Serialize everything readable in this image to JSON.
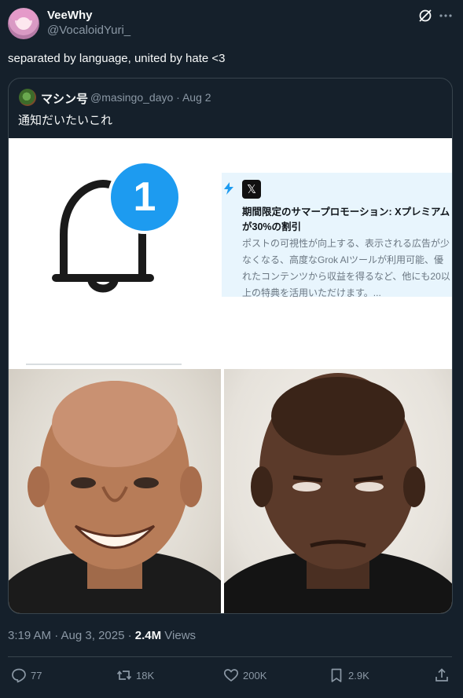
{
  "tweet": {
    "author_name": "VeeWhy",
    "author_handle": "@VocaloidYuri_",
    "text": "separated by language, united by hate <3",
    "timestamp": "3:19 AM · Aug 3, 2025 · ",
    "views_count": "2.4M",
    "views_label": " Views"
  },
  "quote": {
    "author_name": "マシン号",
    "author_handle": "@masingo_dayo · Aug 2",
    "text": "通知だいたいこれ",
    "notification_count": "1",
    "promo": {
      "logo": "𝕏",
      "title": "期間限定のサマープロモーション: Xプレミアムが30%の割引",
      "body": "ポストの可視性が向上する、表示される広告が少なくなる、高度なGrok AIツールが利用可能、優れたコンテンツから収益を得るなど、他にも20以上の特典を活用いただけます。..."
    }
  },
  "actions": {
    "replies": "77",
    "reposts": "18K",
    "likes": "200K",
    "bookmarks": "2.9K"
  },
  "icons": [
    "grok-icon",
    "more-icon",
    "bell-icon",
    "lightning-icon",
    "x-logo-icon",
    "reply-icon",
    "repost-icon",
    "like-icon",
    "bookmark-icon",
    "share-icon"
  ],
  "colors": {
    "background": "#15202b",
    "text": "#f7f9f9",
    "muted": "#8b98a5",
    "border": "#38444d",
    "badge_blue": "#1d9bf0"
  }
}
